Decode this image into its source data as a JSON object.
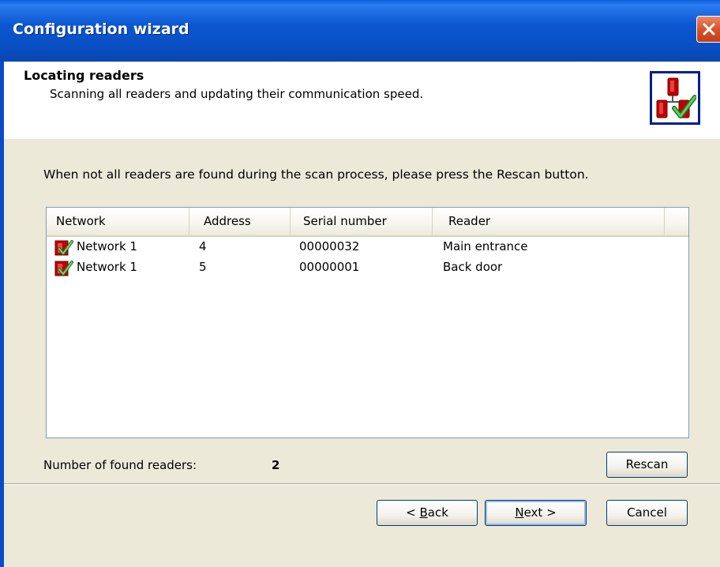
{
  "window": {
    "title": "Configuration wizard"
  },
  "header": {
    "title": "Locating readers",
    "subtitle": "Scanning all readers and updating their communication speed."
  },
  "instruction": "When not all readers are found during the scan process, please press the Rescan button.",
  "list": {
    "columns": [
      "Network",
      "Address",
      "Serial number",
      "Reader"
    ],
    "rows": [
      {
        "network": "Network 1",
        "address": "4",
        "serial": "00000032",
        "reader": "Main entrance"
      },
      {
        "network": "Network 1",
        "address": "5",
        "serial": "00000001",
        "reader": "Back door"
      }
    ]
  },
  "found": {
    "label": "Number of found readers:",
    "count": "2"
  },
  "buttons": {
    "rescan": "Rescan",
    "back_prefix": "< ",
    "back_key": "B",
    "back_rest": "ack",
    "next_key": "N",
    "next_rest": "ext >",
    "cancel": "Cancel"
  },
  "colors": {
    "titlebar": "#0b57d0",
    "accent_check": "#2fa02f",
    "reader_red": "#c00000"
  }
}
